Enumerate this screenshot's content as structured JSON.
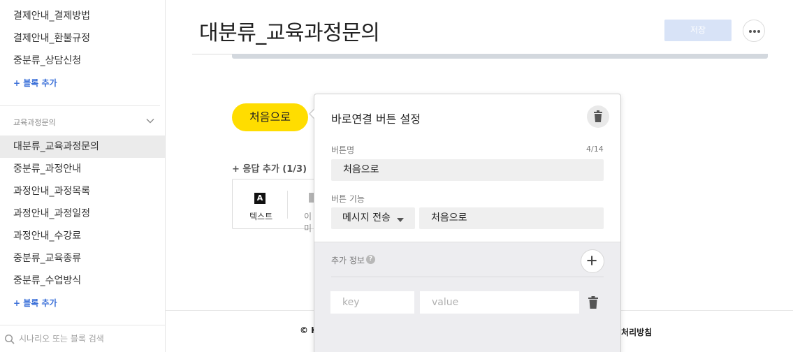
{
  "sidebar": {
    "items_top": [
      "결제안내_결제방법",
      "결제안내_환불규정",
      "중분류_상담신청"
    ],
    "add_block_1": "+ 블록 추가",
    "group_label": "교육과정문의",
    "items_group": [
      "대분류_교육과정문의",
      "중분류_과정안내",
      "과정안내_과정목록",
      "과정안내_과정일정",
      "과정안내_수강료",
      "중분류_교육종류",
      "중분류_수업방식"
    ],
    "active_item": "대분류_교육과정문의",
    "add_block_2": "+ 블록 추가",
    "search_placeholder": "시나리오 또는 블록 검색"
  },
  "header": {
    "title": "대분류_교육과정문의",
    "save_label": "저장"
  },
  "main": {
    "quick_reply_label": "처음으로",
    "add_response": "+ 응답 추가 (1/3)",
    "type_text_icon": "A",
    "type_text_label": "텍스트",
    "type_image_label": "이미",
    "footer_left": "© K",
    "footer_right": "보처리방침"
  },
  "panel": {
    "title": "바로연결 버튼 설정",
    "name_label": "버튼명",
    "name_counter": "4/14",
    "name_value": "처음으로",
    "function_label": "버튼 기능",
    "function_selected": "메시지 전송",
    "function_value": "처음으로",
    "extra_label": "추가 정보",
    "help_glyph": "?",
    "key_placeholder": "key",
    "value_placeholder": "value"
  },
  "colors": {
    "accent_yellow": "#ffdd00",
    "link_blue": "#3a6fd8",
    "save_disabled": "#d8e3f7",
    "active_bg": "#ebebeb"
  }
}
